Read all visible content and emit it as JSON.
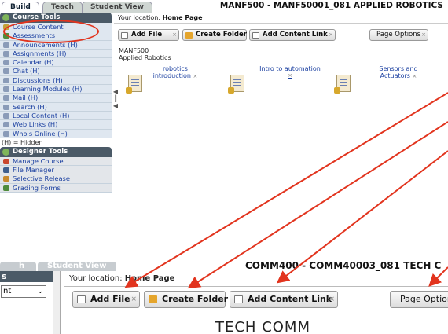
{
  "top": {
    "tabs": [
      {
        "label": "Build",
        "active": true
      },
      {
        "label": "Teach",
        "active": false
      },
      {
        "label": "Student View",
        "active": false
      }
    ],
    "course_title": "MANF500 - MANF50001_081 APPLIED ROBOTICS",
    "sidebar": {
      "course_tools_heading": "Course Tools",
      "course_tools": [
        {
          "label": "Course Content",
          "icon": "course-content-icon",
          "color": "#c4a23a"
        },
        {
          "label": "Assessments",
          "icon": "assessments-icon",
          "color": "#4f8b3b"
        },
        {
          "label": "Announcements (H)",
          "icon": "announcements-icon",
          "color": "#8a9bb8"
        },
        {
          "label": "Assignments (H)",
          "icon": "assignments-icon",
          "color": "#8a9bb8"
        },
        {
          "label": "Calendar (H)",
          "icon": "calendar-icon",
          "color": "#8a9bb8"
        },
        {
          "label": "Chat (H)",
          "icon": "chat-icon",
          "color": "#8a9bb8"
        },
        {
          "label": "Discussions (H)",
          "icon": "discussions-icon",
          "color": "#8a9bb8"
        },
        {
          "label": "Learning Modules (H)",
          "icon": "learning-modules-icon",
          "color": "#8a9bb8"
        },
        {
          "label": "Mail (H)",
          "icon": "mail-icon",
          "color": "#8a9bb8"
        },
        {
          "label": "Search (H)",
          "icon": "search-icon",
          "color": "#8a9bb8"
        },
        {
          "label": "Local Content (H)",
          "icon": "local-content-icon",
          "color": "#8a9bb8"
        },
        {
          "label": "Web Links (H)",
          "icon": "web-links-icon",
          "color": "#8a9bb8"
        },
        {
          "label": "Who's Online (H)",
          "icon": "whos-online-icon",
          "color": "#8a9bb8"
        }
      ],
      "hidden_note": "(H) = Hidden",
      "designer_tools_heading": "Designer Tools",
      "designer_tools": [
        {
          "label": "Manage Course",
          "icon": "manage-course-icon",
          "color": "#c9472e"
        },
        {
          "label": "File Manager",
          "icon": "file-manager-icon",
          "color": "#3f5f8f"
        },
        {
          "label": "Selective Release",
          "icon": "selective-release-icon",
          "color": "#c98a2e"
        },
        {
          "label": "Grading Forms",
          "icon": "grading-forms-icon",
          "color": "#4f8b3b"
        }
      ]
    },
    "location_prefix": "Your location:",
    "location_page": "Home Page",
    "toolbar": {
      "add_file": "Add File",
      "create_folder": "Create Folder",
      "add_content_link": "Add Content Link",
      "page_options": "Page Options"
    },
    "course_code": "MANF500",
    "course_name": "Applied Robotics",
    "items": [
      {
        "label_line1": "robotics",
        "label_line2": "introduction"
      },
      {
        "label_line1": "Intro to automation",
        "label_line2": ""
      },
      {
        "label_line1": "Sensors and",
        "label_line2": "Actuators"
      }
    ]
  },
  "bottom": {
    "tabs": [
      "h",
      "Student View"
    ],
    "course_title": "COMM400 - COMM40003_081 TECH C",
    "sidebar_select_value": "nt",
    "location_prefix": "Your location:",
    "location_page": "Home Page",
    "toolbar": {
      "add_file": "Add File",
      "create_folder": "Create Folder",
      "add_content_link": "Add Content Link",
      "page_options": "Page Options"
    },
    "content_heading": "TECH COMM"
  },
  "colors": {
    "annotation": "#e2341e",
    "sidebar_header": "#4b5a67",
    "link": "#1a3fa0"
  }
}
